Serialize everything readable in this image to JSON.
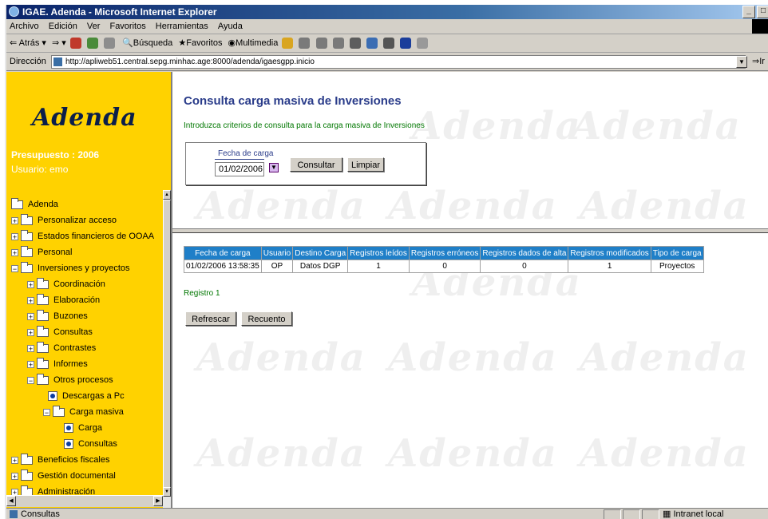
{
  "window": {
    "title": "IGAE. Adenda - Microsoft Internet Explorer"
  },
  "menu": [
    "Archivo",
    "Edición",
    "Ver",
    "Favoritos",
    "Herramientas",
    "Ayuda"
  ],
  "toolbar": {
    "back": "Atrás",
    "search": "Búsqueda",
    "favorites": "Favoritos",
    "multimedia": "Multimedia"
  },
  "address": {
    "label": "Dirección",
    "url": "http://apliweb51.central.sepg.minhac.age:8000/adenda/igaesgpp.inicio",
    "go": "Ir"
  },
  "sidebar": {
    "logo": "Adenda",
    "presupuesto": "Presupuesto : 2006",
    "usuario": "Usuario: emo",
    "tree": [
      {
        "label": "Adenda"
      },
      {
        "label": "Personalizar acceso"
      },
      {
        "label": "Estados financieros de OOAA"
      },
      {
        "label": "Personal"
      },
      {
        "label": "Inversiones y proyectos"
      },
      {
        "label": "Coordinación"
      },
      {
        "label": "Elaboración"
      },
      {
        "label": "Buzones"
      },
      {
        "label": "Consultas"
      },
      {
        "label": "Contrastes"
      },
      {
        "label": "Informes"
      },
      {
        "label": "Otros procesos"
      },
      {
        "label": "Descargas a Pc"
      },
      {
        "label": "Carga masiva"
      },
      {
        "label": "Carga"
      },
      {
        "label": "Consultas"
      },
      {
        "label": "Beneficios fiscales"
      },
      {
        "label": "Gestión documental"
      },
      {
        "label": "Administración"
      }
    ]
  },
  "main": {
    "title": "Consulta carga masiva de Inversiones",
    "subtitle": "Introduzca criterios de consulta para la carga masiva de Inversiones",
    "filter": {
      "label": "Fecha de carga",
      "value": "01/02/2006"
    },
    "buttons": {
      "consultar": "Consultar",
      "limpiar": "Limpiar",
      "refrescar": "Refrescar",
      "recuento": "Recuento"
    },
    "table": {
      "headers": [
        "Fecha de carga",
        "Usuario",
        "Destino Carga",
        "Registros leídos",
        "Registros erróneos",
        "Registros dados de alta",
        "Registros modificados",
        "Tipo de carga"
      ],
      "rows": [
        [
          "01/02/2006 13:58:35",
          "OP",
          "Datos DGP",
          "1",
          "0",
          "0",
          "1",
          "Proyectos"
        ]
      ]
    },
    "registro": "Registro 1",
    "watermark": "Adenda"
  },
  "statusbar": {
    "text": "Consultas",
    "zone": "Intranet local"
  }
}
